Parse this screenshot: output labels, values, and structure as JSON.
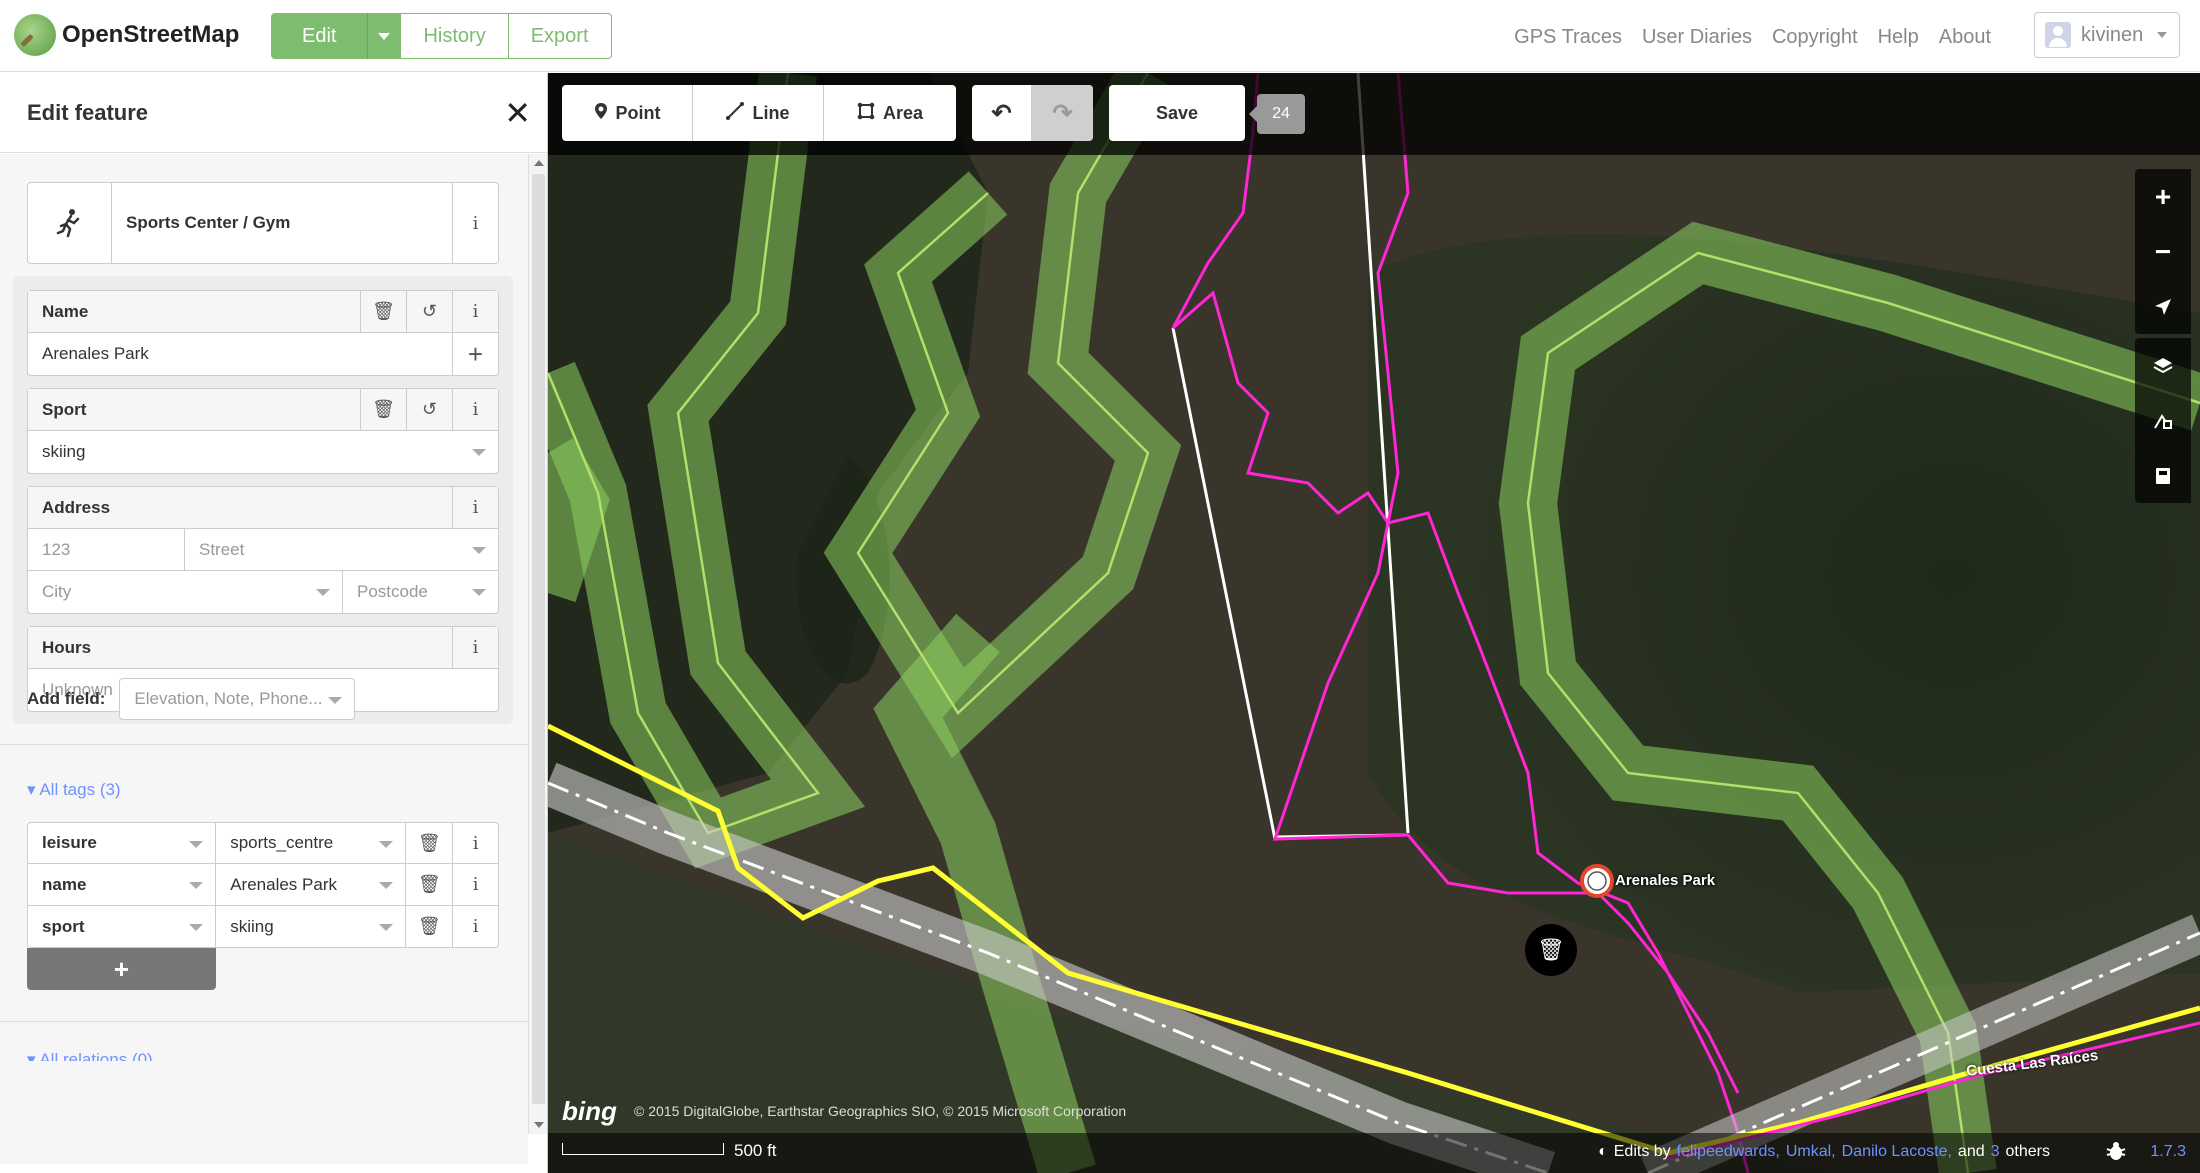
{
  "header": {
    "brand": "OpenStreetMap",
    "edit_label": "Edit",
    "history_label": "History",
    "export_label": "Export",
    "nav": [
      "GPS Traces",
      "User Diaries",
      "Copyright",
      "Help",
      "About"
    ],
    "username": "kivinen"
  },
  "sidebar": {
    "title": "Edit feature",
    "close_icon": "✕",
    "preset": {
      "label": "Sports Center / Gym",
      "icon": "person-running-icon"
    },
    "fields": {
      "name": {
        "label": "Name",
        "value": "Arenales Park"
      },
      "sport": {
        "label": "Sport",
        "value": "skiing"
      },
      "address": {
        "label": "Address",
        "housenumber_placeholder": "123",
        "street_placeholder": "Street",
        "city_placeholder": "City",
        "postcode_placeholder": "Postcode"
      },
      "hours": {
        "label": "Hours",
        "placeholder": "Unknown"
      }
    },
    "add_field": {
      "label": "Add field:",
      "placeholder": "Elevation, Note, Phone..."
    },
    "all_tags_label": "All tags (3)",
    "tags": [
      {
        "key": "leisure",
        "value": "sports_centre"
      },
      {
        "key": "name",
        "value": "Arenales Park"
      },
      {
        "key": "sport",
        "value": "skiing"
      }
    ],
    "add_tag_symbol": "+",
    "all_relations_label": "All relations (0)"
  },
  "map": {
    "toolbar": {
      "point_label": "Point",
      "line_label": "Line",
      "area_label": "Area",
      "save_label": "Save",
      "edit_count": "24"
    },
    "poi_label": "Arenales Park",
    "road_label": "Cuesta Las Raíces",
    "scale_label": "500 ft",
    "imagery_brand": "bing",
    "imagery_copyright": "© 2015 DigitalGlobe, Earthstar Geographics SIO, © 2015 Microsoft Corporation",
    "attribution": {
      "prefix": "Edits by",
      "user1": "felipeedwards,",
      "user2": "Umkal,",
      "user3": "Danilo Lacoste,",
      "and": "and",
      "others_count": "3",
      "others": "others"
    },
    "version": "1.7.3",
    "colors": {
      "accent": "#7ebc6f",
      "link": "#7092ff",
      "gps_trace": "#ff26d4",
      "road": "#ffff33",
      "park_fill": "#8cd05f"
    }
  }
}
